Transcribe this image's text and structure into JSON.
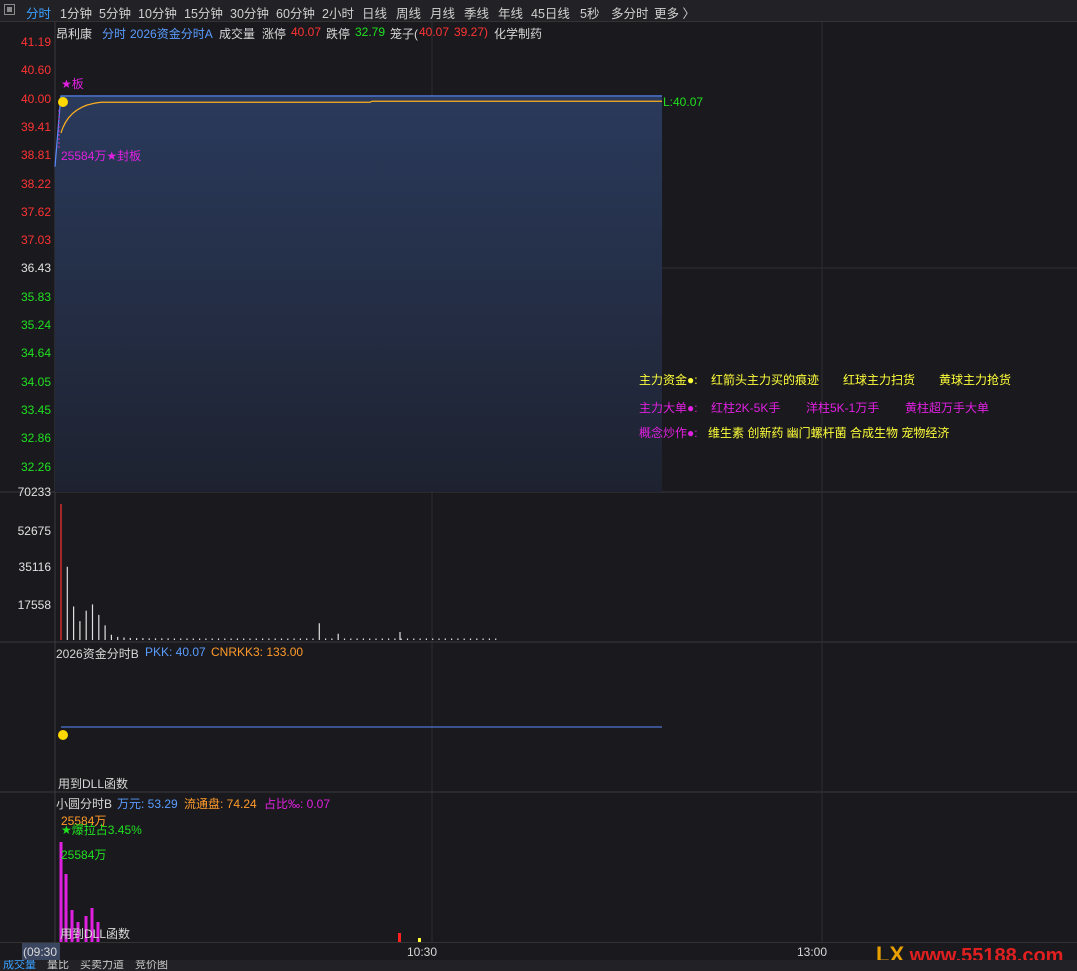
{
  "toolbar": {
    "items": [
      "分时",
      "1分钟",
      "5分钟",
      "10分钟",
      "15分钟",
      "30分钟",
      "60分钟",
      "2小时",
      "日线",
      "周线",
      "月线",
      "季线",
      "年线",
      "45日线",
      "5秒",
      "多分时",
      "更多 〉"
    ]
  },
  "price_panel": {
    "stock_name": "昂利康",
    "title_prefix": "分时",
    "indicator": "2026资金分时A",
    "vol_label": "成交量",
    "limit_up_label": "涨停",
    "limit_up_value": "40.07",
    "limit_down_label": "跌停",
    "limit_down_value": "32.79",
    "cage_label": "笼子(",
    "cage_v1": "40.07",
    "cage_v2": "39.27)",
    "sector": "化学制药",
    "y_ticks": [
      "41.19",
      "40.60",
      "40.00",
      "39.41",
      "38.81",
      "38.22",
      "37.62",
      "37.03",
      "36.43",
      "35.83",
      "35.24",
      "34.64",
      "34.05",
      "33.45",
      "32.86",
      "32.26"
    ],
    "star_label": "★板",
    "seal_label": "25584万★封板",
    "price_tag": "L:40.07",
    "legend_rows": [
      {
        "title": "主力资金●:",
        "items": [
          "红箭头主力买的痕迹",
          "红球主力扫货",
          "黄球主力抢货"
        ]
      },
      {
        "title": "主力大单●:",
        "items": [
          "红柱2K-5K手",
          "洋柱5K-1万手",
          "黄柱超万手大单"
        ]
      },
      {
        "title": "概念炒作●:",
        "items": [
          "维生素 创新药 幽门螺杆菌 合成生物 宠物经济"
        ]
      }
    ]
  },
  "volume_panel": {
    "y_ticks": [
      "70233",
      "52675",
      "35116",
      "17558"
    ]
  },
  "chart_data": {
    "type": "line",
    "price_series": {
      "name": "",
      "start": 38.6,
      "limit_up": 40.07,
      "avg_line": 39.96,
      "ylim": [
        32.26,
        41.19
      ]
    },
    "volume_series": {
      "ylim": [
        0,
        70233
      ],
      "bars": [
        65000,
        35000,
        16000,
        9000,
        14000,
        17000,
        12000,
        7000,
        2500,
        1500,
        1200,
        1000,
        900,
        900,
        800,
        800,
        800,
        800,
        700,
        700,
        700,
        700,
        700,
        700,
        700,
        600,
        600,
        600,
        600,
        600,
        600,
        600,
        600,
        600,
        600,
        600,
        600,
        600,
        600,
        600,
        600,
        8000,
        600,
        600,
        3000,
        600,
        600,
        600,
        600,
        600,
        600,
        600,
        600,
        600,
        600,
        600,
        600,
        600,
        600,
        600,
        600,
        600,
        600,
        600,
        600,
        600,
        600,
        600,
        600,
        600
      ]
    }
  },
  "panel_b": {
    "title": "2026资金分时B",
    "pkk_label": "PKK: 40.07",
    "cn_label": "CNRKK3: 133.00",
    "dll_label": "用到DLL函数"
  },
  "panel_c": {
    "title": "小圆分时B",
    "wan_label": "万元: 53.29",
    "float_label": "流通盘: 74.24",
    "pct_label": "占比‰: 0.07",
    "label1": "25584万",
    "label2": "★爆拉占3.45%",
    "label3": "25584万",
    "dll_label": "用到DLL函数"
  },
  "time_axis": {
    "ticks": [
      "(09:30",
      "10:30",
      "13:00"
    ]
  },
  "bottom_tabs": [
    "成交量",
    "量比",
    "买卖力道",
    "竞价图"
  ],
  "watermark": "LX www.55188.com"
}
